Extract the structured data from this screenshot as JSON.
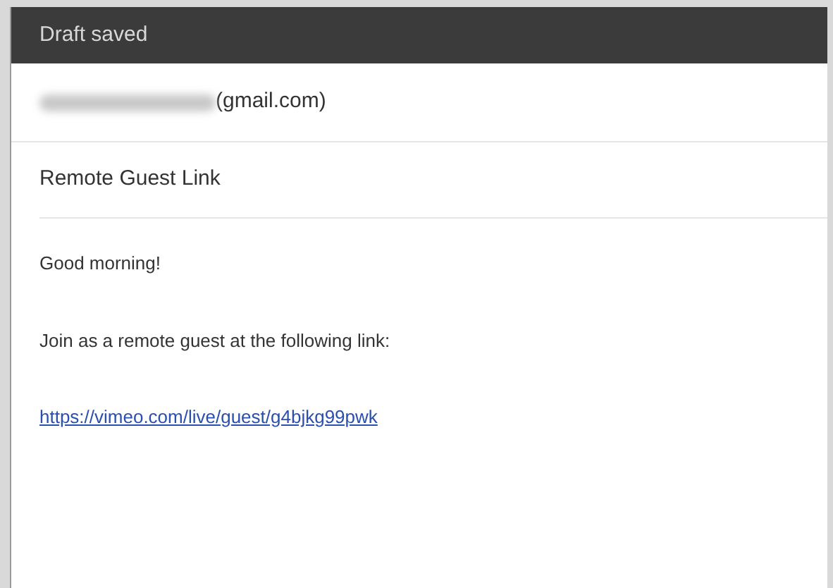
{
  "header": {
    "title": "Draft saved"
  },
  "recipient": {
    "domain": "(gmail.com)"
  },
  "subject": "Remote Guest Link",
  "body": [
    {
      "kind": "text",
      "text": "Good morning!"
    },
    {
      "kind": "text",
      "text": "Join as a remote guest at the following link:"
    },
    {
      "kind": "link",
      "text": "https://vimeo.com/live/guest/g4bjkg99pwk"
    }
  ]
}
